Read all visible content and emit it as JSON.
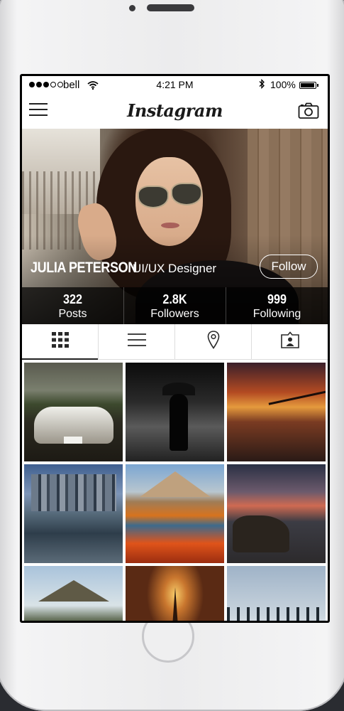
{
  "status_bar": {
    "carrier": "bell",
    "time": "4:21 PM",
    "battery": "100%",
    "battery_level": 1.0,
    "signal_bars_filled": 3,
    "signal_bars_total": 5,
    "icons": [
      "signal-dots-icon",
      "wifi-icon",
      "bluetooth-icon",
      "battery-icon"
    ]
  },
  "nav": {
    "title": "Instagram",
    "left_icon": "hamburger-menu-icon",
    "right_icon": "camera-icon"
  },
  "profile": {
    "name": "JULIA PETERSON",
    "role": "UI/UX Designer",
    "follow_label": "Follow",
    "stats": [
      {
        "value": "322",
        "label": "Posts"
      },
      {
        "value": "2.8K",
        "label": "Followers"
      },
      {
        "value": "999",
        "label": "Following"
      }
    ]
  },
  "tabs": [
    {
      "icon": "grid-icon",
      "active": true
    },
    {
      "icon": "list-icon",
      "active": false
    },
    {
      "icon": "location-pin-icon",
      "active": false
    },
    {
      "icon": "tagged-person-icon",
      "active": false
    }
  ],
  "photos": [
    "classic-car-sunset",
    "umbrella-silhouette-rain",
    "bridge-sunset-beach",
    "city-skyline-reflection",
    "autumn-mountain-lake",
    "coastal-rocks-sunset",
    "volcano-landscape",
    "eiffel-tower-fog",
    "snowy-treeline"
  ],
  "colors": {
    "phone_body": "#ececed",
    "background": "#2a2c31",
    "stats_bar": "#000000"
  }
}
